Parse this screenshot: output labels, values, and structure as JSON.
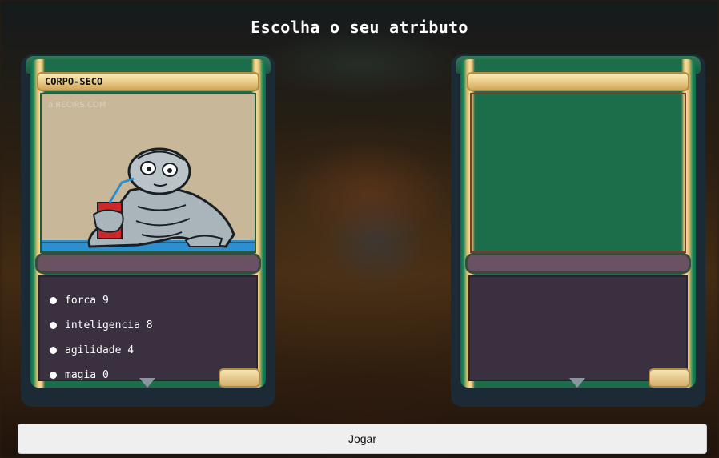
{
  "header": {
    "title": "Escolha o seu atributo"
  },
  "player_card": {
    "name": "CORPO-SECO",
    "watermark": "a.RECIRS.COM",
    "attributes": [
      {
        "label": "forca 9"
      },
      {
        "label": "inteligencia 8"
      },
      {
        "label": "agilidade 4"
      },
      {
        "label": "magia 0"
      }
    ]
  },
  "opponent_card": {
    "name": ""
  },
  "actions": {
    "play_label": "Jogar"
  },
  "colors": {
    "panel": "#1c2a36",
    "gold": "#e8c986",
    "text_box": "#3b3040",
    "type_bar": "#6a5262"
  }
}
